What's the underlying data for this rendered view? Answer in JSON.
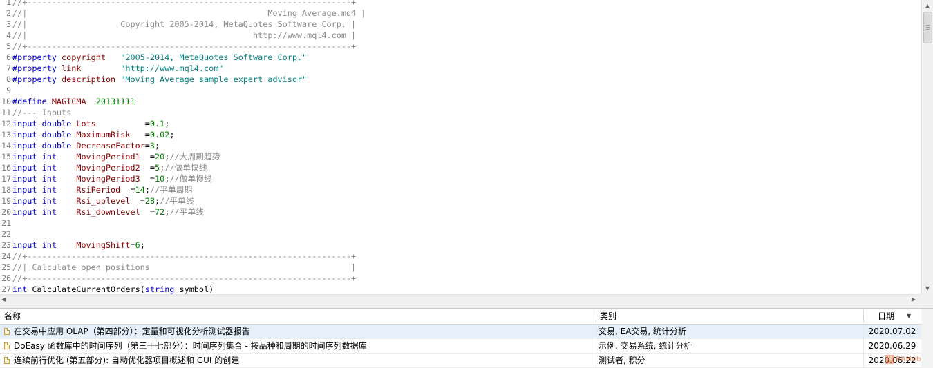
{
  "editor": {
    "lines": [
      {
        "n": "1",
        "t": [
          {
            "c": "comment",
            "v": "//+------------------------------------------------------------------+"
          }
        ]
      },
      {
        "n": "2",
        "t": [
          {
            "c": "comment",
            "v": "//|                                                 Moving Average.mq4 |"
          }
        ]
      },
      {
        "n": "3",
        "t": [
          {
            "c": "comment",
            "v": "//|                   Copyright 2005-2014, MetaQuotes Software Corp. |"
          }
        ]
      },
      {
        "n": "4",
        "t": [
          {
            "c": "comment",
            "v": "//|                                              http://www.mql4.com |"
          }
        ]
      },
      {
        "n": "5",
        "t": [
          {
            "c": "comment",
            "v": "//+------------------------------------------------------------------+"
          }
        ]
      },
      {
        "n": "6",
        "t": [
          {
            "c": "prep",
            "v": "#property "
          },
          {
            "c": "name",
            "v": "copyright   "
          },
          {
            "c": "str",
            "v": "\"2005-2014, MetaQuotes Software Corp.\""
          }
        ]
      },
      {
        "n": "7",
        "t": [
          {
            "c": "prep",
            "v": "#property "
          },
          {
            "c": "name",
            "v": "link        "
          },
          {
            "c": "str",
            "v": "\"http://www.mql4.com\""
          }
        ]
      },
      {
        "n": "8",
        "t": [
          {
            "c": "prep",
            "v": "#property "
          },
          {
            "c": "name",
            "v": "description "
          },
          {
            "c": "str",
            "v": "\"Moving Average sample expert advisor\""
          }
        ]
      },
      {
        "n": "9",
        "t": []
      },
      {
        "n": "10",
        "t": [
          {
            "c": "prep",
            "v": "#define "
          },
          {
            "c": "name",
            "v": "MAGICMA"
          },
          {
            "c": "plain",
            "v": "  "
          },
          {
            "c": "num",
            "v": "20131111"
          }
        ]
      },
      {
        "n": "11",
        "t": [
          {
            "c": "comment",
            "v": "//--- Inputs"
          }
        ]
      },
      {
        "n": "12",
        "t": [
          {
            "c": "kw",
            "v": "input double "
          },
          {
            "c": "name",
            "v": "Lots          "
          },
          {
            "c": "plain",
            "v": "="
          },
          {
            "c": "num",
            "v": "0.1"
          },
          {
            "c": "plain",
            "v": ";"
          }
        ]
      },
      {
        "n": "13",
        "t": [
          {
            "c": "kw",
            "v": "input double "
          },
          {
            "c": "name",
            "v": "MaximumRisk   "
          },
          {
            "c": "plain",
            "v": "="
          },
          {
            "c": "num",
            "v": "0.02"
          },
          {
            "c": "plain",
            "v": ";"
          }
        ]
      },
      {
        "n": "14",
        "t": [
          {
            "c": "kw",
            "v": "input double "
          },
          {
            "c": "name",
            "v": "DecreaseFactor"
          },
          {
            "c": "plain",
            "v": "="
          },
          {
            "c": "num",
            "v": "3"
          },
          {
            "c": "plain",
            "v": ";"
          }
        ]
      },
      {
        "n": "15",
        "t": [
          {
            "c": "kw",
            "v": "input int    "
          },
          {
            "c": "name",
            "v": "MovingPeriod1  "
          },
          {
            "c": "plain",
            "v": "="
          },
          {
            "c": "num",
            "v": "20"
          },
          {
            "c": "plain",
            "v": ";"
          },
          {
            "c": "comment",
            "v": "//大周期趋势"
          }
        ]
      },
      {
        "n": "16",
        "t": [
          {
            "c": "kw",
            "v": "input int    "
          },
          {
            "c": "name",
            "v": "MovingPeriod2  "
          },
          {
            "c": "plain",
            "v": "="
          },
          {
            "c": "num",
            "v": "5"
          },
          {
            "c": "plain",
            "v": ";"
          },
          {
            "c": "comment",
            "v": "//做单快线"
          }
        ]
      },
      {
        "n": "17",
        "t": [
          {
            "c": "kw",
            "v": "input int    "
          },
          {
            "c": "name",
            "v": "MovingPeriod3  "
          },
          {
            "c": "plain",
            "v": "="
          },
          {
            "c": "num",
            "v": "10"
          },
          {
            "c": "plain",
            "v": ";"
          },
          {
            "c": "comment",
            "v": "//做单慢线"
          }
        ]
      },
      {
        "n": "18",
        "t": [
          {
            "c": "kw",
            "v": "input int    "
          },
          {
            "c": "name",
            "v": "RsiPeriod  "
          },
          {
            "c": "plain",
            "v": "="
          },
          {
            "c": "num",
            "v": "14"
          },
          {
            "c": "plain",
            "v": ";"
          },
          {
            "c": "comment",
            "v": "//平单周期"
          }
        ]
      },
      {
        "n": "19",
        "t": [
          {
            "c": "kw",
            "v": "input int    "
          },
          {
            "c": "name",
            "v": "Rsi_uplevel  "
          },
          {
            "c": "plain",
            "v": "="
          },
          {
            "c": "num",
            "v": "28"
          },
          {
            "c": "plain",
            "v": ";"
          },
          {
            "c": "comment",
            "v": "//平单线"
          }
        ]
      },
      {
        "n": "20",
        "t": [
          {
            "c": "kw",
            "v": "input int    "
          },
          {
            "c": "name",
            "v": "Rsi_downlevel  "
          },
          {
            "c": "plain",
            "v": "="
          },
          {
            "c": "num",
            "v": "72"
          },
          {
            "c": "plain",
            "v": ";"
          },
          {
            "c": "comment",
            "v": "//平单线"
          }
        ]
      },
      {
        "n": "21",
        "t": []
      },
      {
        "n": "22",
        "t": []
      },
      {
        "n": "23",
        "t": [
          {
            "c": "kw",
            "v": "input int    "
          },
          {
            "c": "name",
            "v": "MovingShift"
          },
          {
            "c": "plain",
            "v": "="
          },
          {
            "c": "num",
            "v": "6"
          },
          {
            "c": "plain",
            "v": ";"
          }
        ]
      },
      {
        "n": "24",
        "t": [
          {
            "c": "comment",
            "v": "//+------------------------------------------------------------------+"
          }
        ]
      },
      {
        "n": "25",
        "t": [
          {
            "c": "comment",
            "v": "//| Calculate open positions                                         |"
          }
        ]
      },
      {
        "n": "26",
        "t": [
          {
            "c": "comment",
            "v": "//+------------------------------------------------------------------+"
          }
        ]
      },
      {
        "n": "27",
        "t": [
          {
            "c": "kw",
            "v": "int "
          },
          {
            "c": "plain",
            "v": "CalculateCurrentOrders("
          },
          {
            "c": "kw",
            "v": "string "
          },
          {
            "c": "plain",
            "v": "symbol)"
          }
        ]
      }
    ]
  },
  "articles": {
    "columns": {
      "name": "名称",
      "category": "类别",
      "date": "日期"
    },
    "rows": [
      {
        "name": "在交易中应用 OLAP（第四部分）：定量和可视化分析测试器报告",
        "category": "交易, EA交易, 统计分析",
        "date": "2020.07.02",
        "selected": true
      },
      {
        "name": "DoEasy 函数库中的时间序列（第三十七部分）：时间序列集合 - 按品种和周期的时间序列数据库",
        "category": "示例, 交易系统, 统计分析",
        "date": "2020.06.29",
        "selected": false
      },
      {
        "name": "连续前行优化 (第五部分): 自动优化器项目概述和 GUI 的创建",
        "category": "测试者, 积分",
        "date": "2020.06.22",
        "selected": false
      }
    ]
  },
  "watermark": {
    "text": "EAHub"
  },
  "colors": {
    "keyword": "#0000c8",
    "identifier": "#8b0000",
    "string": "#008080",
    "number": "#008000",
    "comment": "#8a8a8a",
    "selected_row": "#e5f0fb"
  }
}
